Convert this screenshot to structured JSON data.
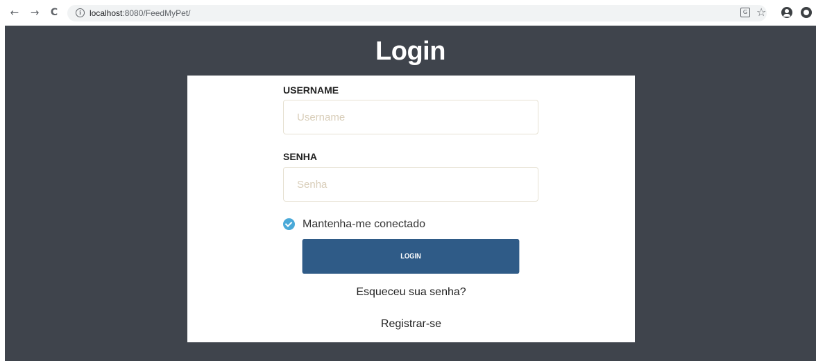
{
  "browser": {
    "url_host": "localhost",
    "url_rest": ":8080/FeedMyPet/",
    "back_glyph": "←",
    "forward_glyph": "→",
    "reload_glyph": "C",
    "info_glyph": "i",
    "translate_glyph": "G",
    "star_glyph": "☆"
  },
  "page": {
    "title": "Login"
  },
  "form": {
    "username_label": "USERNAME",
    "username_placeholder": "Username",
    "username_value": "",
    "password_label": "SENHA",
    "password_placeholder": "Senha",
    "password_value": "",
    "remember_label": "Mantenha-me conectado",
    "remember_checked": true,
    "login_button": "LOGIN",
    "forgot_link": "Esqueceu sua senha?",
    "register_link": "Registrar-se"
  },
  "colors": {
    "page_background": "#3f444c",
    "button": "#2f5b87",
    "checkbox": "#4aa9d8"
  }
}
